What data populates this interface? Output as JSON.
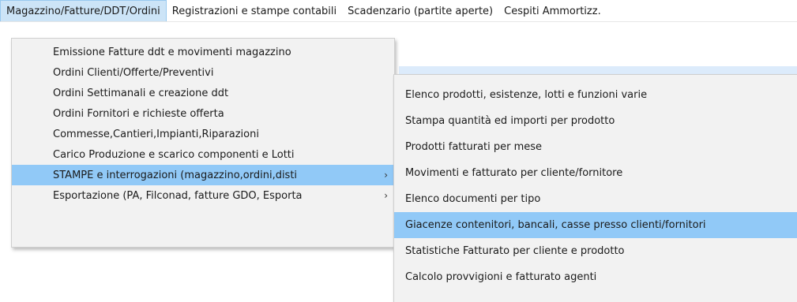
{
  "menubar": {
    "items": [
      {
        "label": "Magazzino/Fatture/DDT/Ordini",
        "active": true
      },
      {
        "label": "Registrazioni e stampe contabili",
        "active": false
      },
      {
        "label": "Scadenzario (partite aperte)",
        "active": false
      },
      {
        "label": "Cespiti Ammortizz.",
        "active": false
      }
    ]
  },
  "dropdown": {
    "items": [
      {
        "label": "Emissione Fatture ddt e movimenti magazzino",
        "submenu": false
      },
      {
        "label": "Ordini Clienti/Offerte/Preventivi",
        "submenu": false
      },
      {
        "label": "Ordini Settimanali e creazione ddt",
        "submenu": false
      },
      {
        "label": "Ordini Fornitori e richieste offerta",
        "submenu": false
      },
      {
        "label": "Commesse,Cantieri,Impianti,Riparazioni",
        "submenu": false
      },
      {
        "label": "Carico Produzione e scarico componenti e Lotti",
        "submenu": false
      },
      {
        "label": "STAMPE e interrogazioni (magazzino,ordini,disti",
        "submenu": true,
        "highlight": true
      },
      {
        "label": "Esportazione (PA, Filconad, fatture GDO, Esporta",
        "submenu": true
      }
    ]
  },
  "submenu": {
    "items": [
      {
        "label": "Elenco prodotti, esistenze, lotti e funzioni varie"
      },
      {
        "label": "Stampa quantità ed importi per prodotto"
      },
      {
        "label": "Prodotti fatturati per mese"
      },
      {
        "label": "Movimenti e fatturato per cliente/fornitore"
      },
      {
        "label": "Elenco documenti per tipo"
      },
      {
        "label": "Giacenze contenitori, bancali, casse presso clienti/fornitori",
        "highlight": true
      },
      {
        "label": "Statistiche Fatturato per cliente e prodotto"
      },
      {
        "label": "Calcolo provvigioni e fatturato agenti"
      }
    ]
  },
  "icons": {
    "submenu_arrow": "›"
  },
  "colors": {
    "highlight": "#91c9f7",
    "active_menubar": "#cce4f7",
    "menu_bg": "#f2f2f2"
  }
}
